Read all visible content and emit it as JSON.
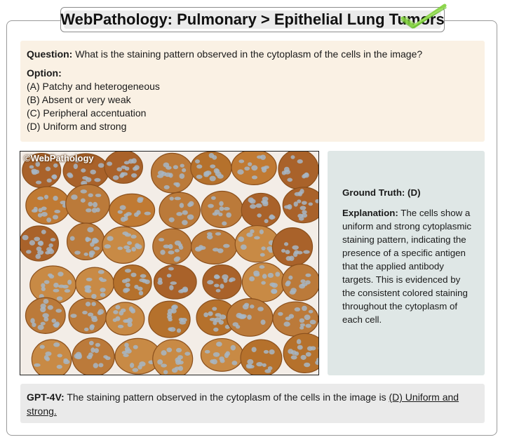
{
  "header": {
    "title": "WebPathology: Pulmonary > Epithelial Lung Tumors"
  },
  "question": {
    "label": "Question:",
    "text": "What is the staining pattern observed in the cytoplasm of the cells in the image?",
    "options_label": "Option:",
    "options": [
      "(A) Patchy and heterogeneous",
      "(B) Absent or very weak",
      "(C) Peripheral accentuation",
      "(D) Uniform and strong"
    ]
  },
  "image": {
    "watermark": "©WebPathology",
    "subject": "immunohistochemistry micrograph"
  },
  "ground_truth": {
    "label": "Ground Truth: (D)",
    "explanation_label": "Explanation:",
    "explanation_text": "The cells show a uniform and strong cytoplasmic staining pattern, indicating the presence of a specific antigen that the applied antibody targets. This is evidenced by the consistent colored staining throughout the cytoplasm of each cell."
  },
  "answer": {
    "model_label": "GPT-4V:",
    "text_before": "The staining pattern observed in the cytoplasm of the cells in the image is",
    "choice": "(D) Uniform and strong."
  },
  "icons": {
    "check": "check-mark-icon"
  },
  "colors": {
    "question_bg": "#faf1e4",
    "ground_truth_bg": "#dfe7e6",
    "answer_bg": "#eaeaea",
    "title_bg": "#ebebeb",
    "check": "#7fd13a",
    "stain_brown": "#b06a28",
    "nuclei_blue": "#9fb0bf"
  }
}
